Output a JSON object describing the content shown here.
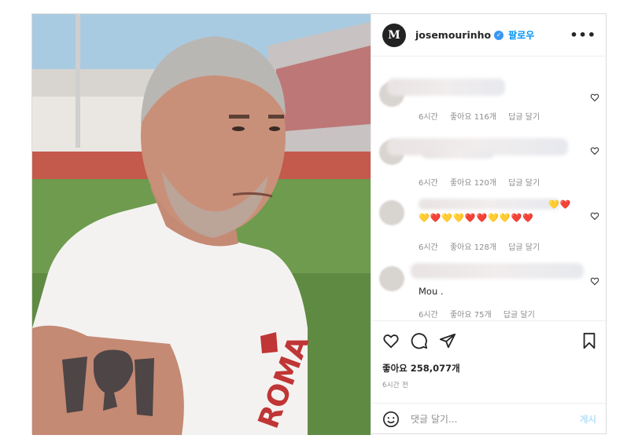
{
  "post": {
    "username": "josemourinho",
    "follow_label": "팔로우",
    "avatar_letter": "M",
    "more_icon": "more-horizontal-icon"
  },
  "comments": [
    {
      "text": "",
      "time": "6시간",
      "likes": "좋아요 116개",
      "reply": "답글 달기"
    },
    {
      "text": "",
      "time": "6시간",
      "likes": "좋아요 120개",
      "reply": "답글 달기"
    },
    {
      "text": "",
      "emojis": "💛❤️💛💛❤️❤️💛💛❤️❤️",
      "time": "6시간",
      "likes": "좋아요 128개",
      "reply": "답글 달기"
    },
    {
      "text": "Mou .",
      "time": "6시간",
      "likes": "좋아요 75개",
      "reply": "답글 달기"
    }
  ],
  "actions": {
    "likes_label": "좋아요 258,077개",
    "time_label": "6시간 전"
  },
  "add_comment": {
    "placeholder": "댓글 달기...",
    "post_label": "게시"
  },
  "colors": {
    "accent": "#0095f6",
    "verified": "#3897f0",
    "muted": "#8e8e8e"
  }
}
